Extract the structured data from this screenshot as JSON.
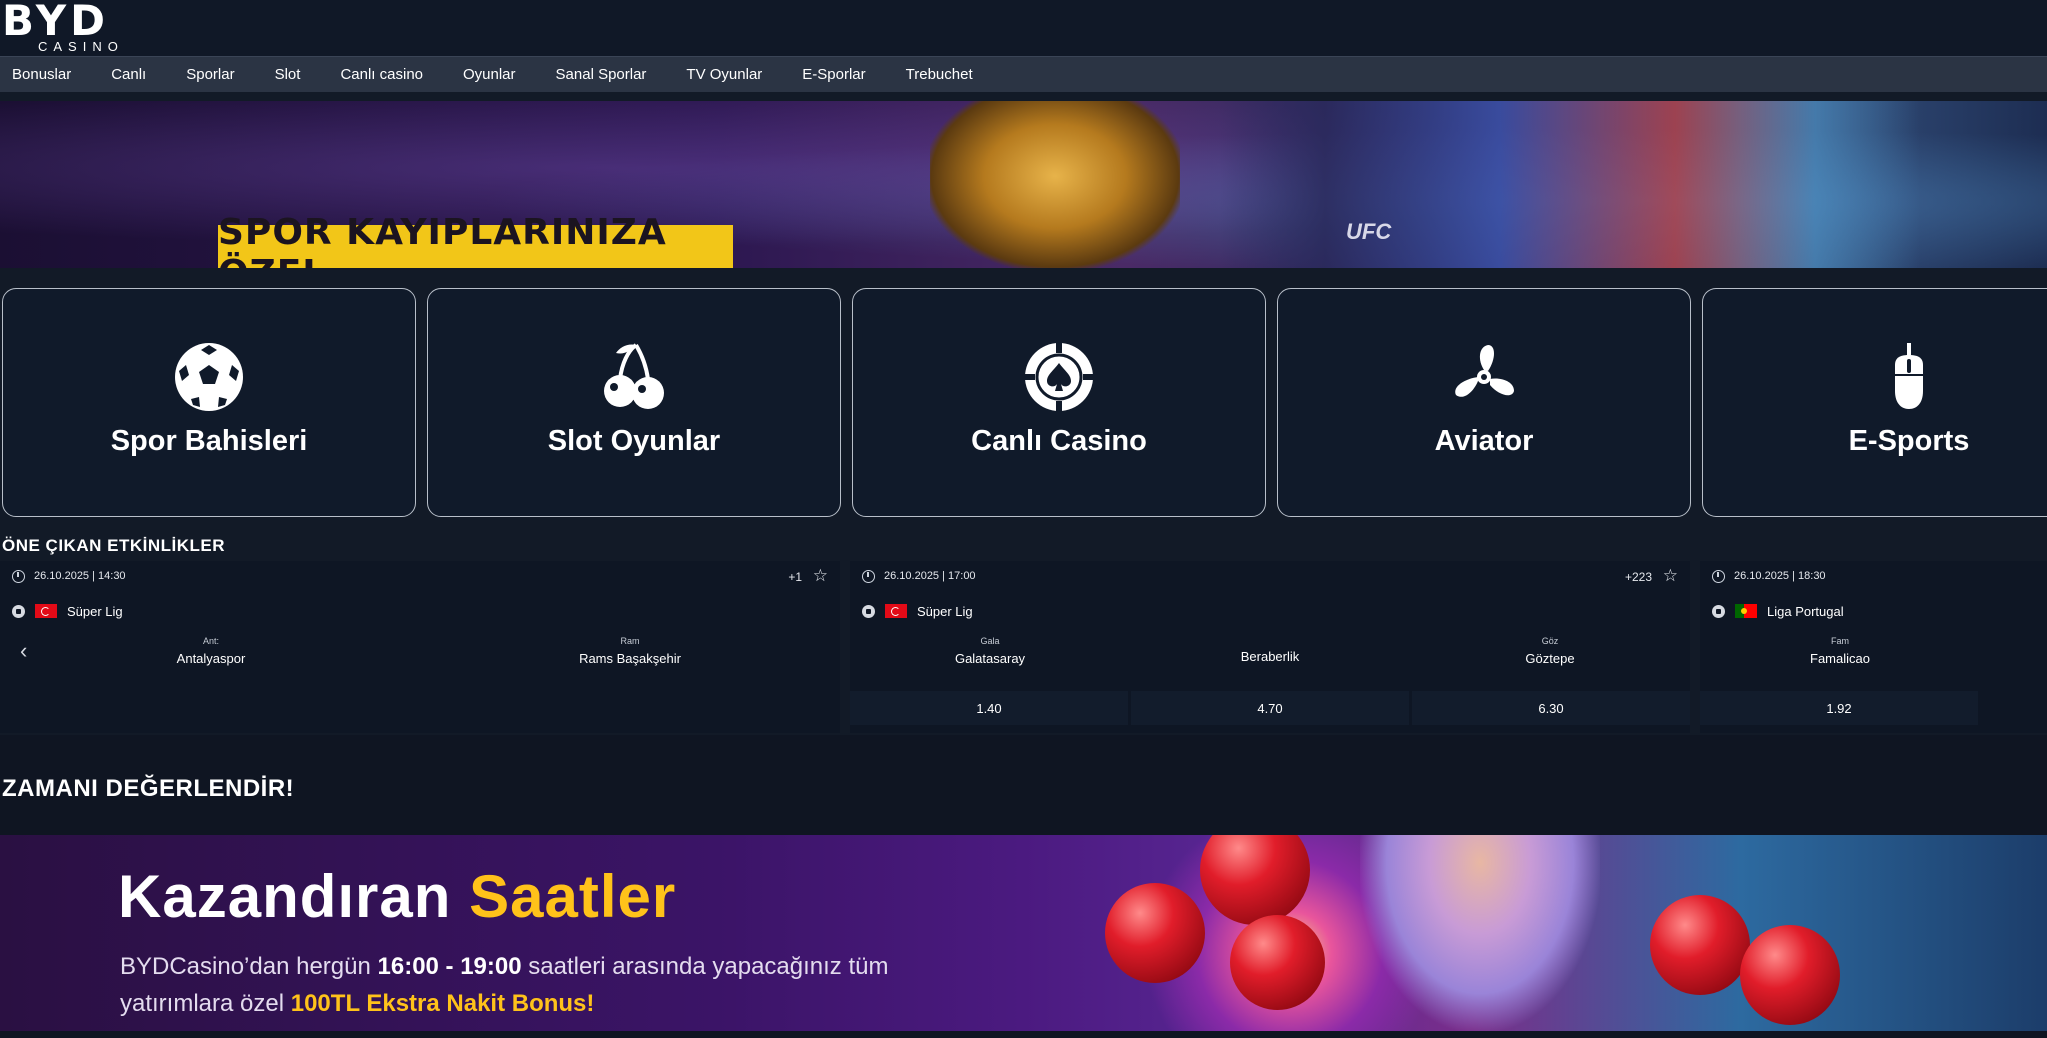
{
  "brand": {
    "logo_text": "BYD",
    "logo_sub": "CASINO"
  },
  "nav": [
    "Bonuslar",
    "Canlı",
    "Sporlar",
    "Slot",
    "Canlı casino",
    "Oyunlar",
    "Sanal Sporlar",
    "TV Oyunlar",
    "E-Sporlar",
    "Trebuchet"
  ],
  "banner1": {
    "title": "SPOR KAYIPLARINIZA ÖZEL",
    "badge": "UFC"
  },
  "categories": [
    {
      "label": "Spor Bahisleri",
      "icon": "soccer-ball-icon"
    },
    {
      "label": "Slot Oyunlar",
      "icon": "cherries-icon"
    },
    {
      "label": "Canlı Casino",
      "icon": "casino-chip-icon"
    },
    {
      "label": "Aviator",
      "icon": "propeller-icon"
    },
    {
      "label": "E-Sports",
      "icon": "mouse-icon"
    }
  ],
  "featured": {
    "title": "ÖNE ÇIKAN ETKİNLİKLER",
    "events": [
      {
        "date": "26.10.2025 | 14:30",
        "more": "+1",
        "league": "Süper Lig",
        "home": "Antalyaspor",
        "home_img_alt": "Ant:",
        "away": "Rams Başakşehir",
        "away_img_alt": "Ram",
        "odds": []
      },
      {
        "date": "26.10.2025 | 17:00",
        "more": "+223",
        "league": "Süper Lig",
        "home": "Galatasaray",
        "home_img_alt": "Gala",
        "draw": "Beraberlik",
        "away": "Göztepe",
        "away_img_alt": "Göz",
        "odds": [
          "1.40",
          "4.70",
          "6.30"
        ]
      },
      {
        "date": "26.10.2025 | 18:30",
        "league": "Liga Portugal",
        "home": "Famalicao",
        "home_img_alt": "Fam",
        "odds": [
          "1.92"
        ]
      }
    ]
  },
  "promo": {
    "section_title": "ZAMANI DEĞERLENDİR!",
    "title_a": "Kazandıran",
    "title_b": "Saatler",
    "line1_a": "BYDCasino’dan hergün",
    "line1_b": "16:00 - 19:00",
    "line1_c": "saatleri arasında yapacağınız tüm",
    "line2_a": "yatırımlara özel",
    "line2_b": "100TL Ekstra Nakit Bonus!"
  },
  "colors": {
    "background": "#121a27",
    "nav": "#2b3444",
    "card_border": "#b8bfc9",
    "banner_yellow": "#f2c618",
    "highlight": "#ffc21a"
  }
}
